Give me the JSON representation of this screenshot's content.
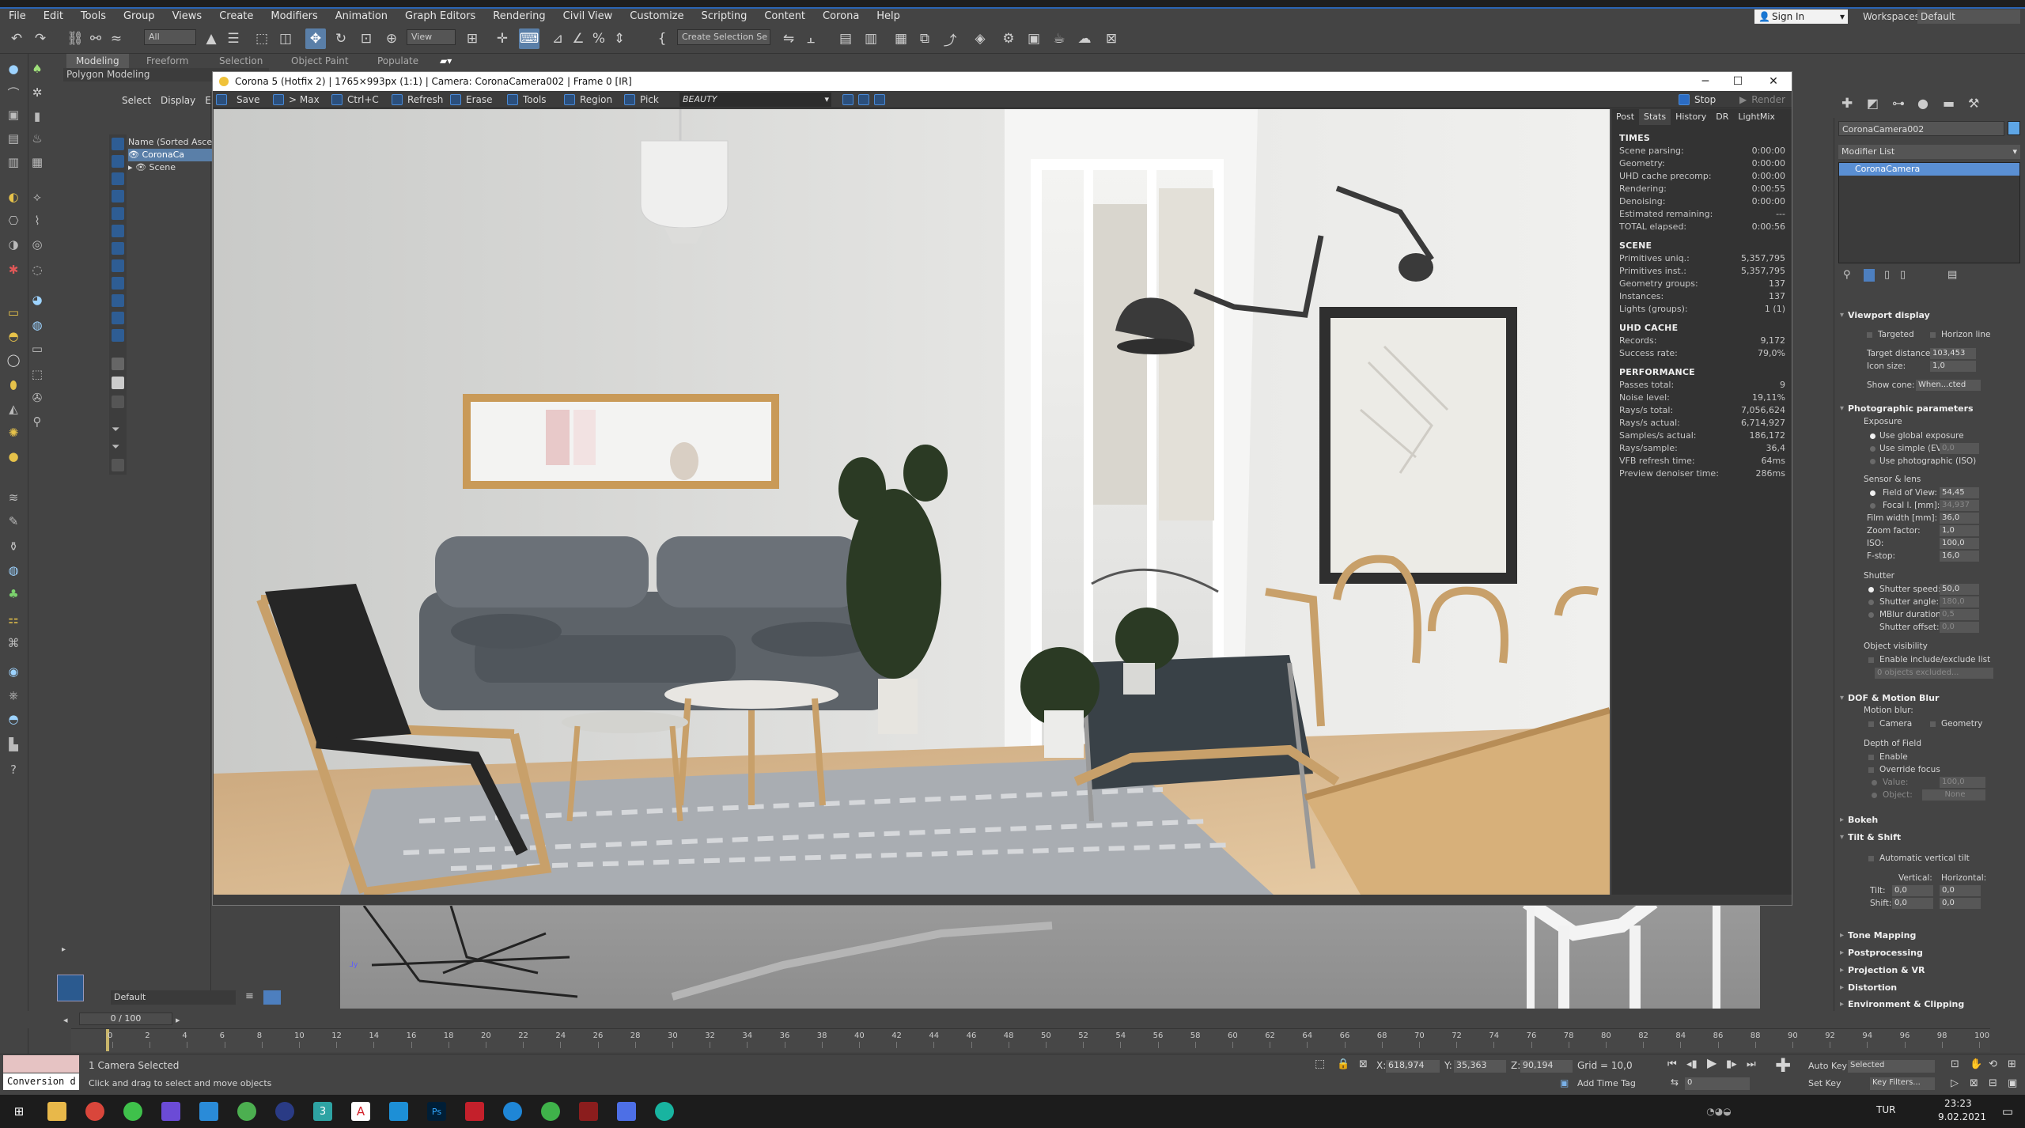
{
  "menu": [
    "File",
    "Edit",
    "Tools",
    "Group",
    "Views",
    "Create",
    "Modifiers",
    "Animation",
    "Graph Editors",
    "Rendering",
    "Civil View",
    "Customize",
    "Scripting",
    "Content",
    "Corona",
    "Help"
  ],
  "account": {
    "sign_in": "Sign In",
    "workspaces_label": "Workspaces:",
    "workspace": "Default"
  },
  "toolbar": {
    "filter": "All",
    "view": "View",
    "selection_set": "Create Selection Se"
  },
  "ribbon": {
    "tabs": [
      "Modeling",
      "Freeform",
      "Selection",
      "Object Paint",
      "Populate"
    ],
    "sub": "Polygon Modeling"
  },
  "scene_explorer": {
    "tabs": [
      "Select",
      "Display",
      "E"
    ],
    "header": "Name (Sorted Ascen",
    "items": [
      "CoronaCa",
      "Scene"
    ]
  },
  "layer": {
    "name": "Default"
  },
  "vfb": {
    "title": "Corona 5 (Hotfix 2) | 1765×993px (1:1) | Camera: CoronaCamera002 | Frame 0 [IR]",
    "toolbar": [
      "Save",
      "> Max",
      "Ctrl+C",
      "Refresh",
      "Erase",
      "Tools",
      "Region",
      "Pick"
    ],
    "channel": "BEAUTY",
    "stop": "Stop",
    "render": "Render",
    "tabs": [
      "Post",
      "Stats",
      "History",
      "DR",
      "LightMix"
    ],
    "stats": [
      {
        "section": "TIMES",
        "rows": [
          [
            "Scene parsing:",
            "0:00:00"
          ],
          [
            "Geometry:",
            "0:00:00"
          ],
          [
            "UHD cache precomp:",
            "0:00:00"
          ],
          [
            "Rendering:",
            "0:00:55"
          ],
          [
            "Denoising:",
            "0:00:00"
          ],
          [
            "Estimated remaining:",
            "---"
          ],
          [
            "TOTAL elapsed:",
            "0:00:56"
          ]
        ]
      },
      {
        "section": "SCENE",
        "rows": [
          [
            "Primitives uniq.:",
            "5,357,795"
          ],
          [
            "Primitives inst.:",
            "5,357,795"
          ],
          [
            "Geometry groups:",
            "137"
          ],
          [
            "Instances:",
            "137"
          ],
          [
            "Lights (groups):",
            "1 (1)"
          ]
        ]
      },
      {
        "section": "UHD CACHE",
        "rows": [
          [
            "Records:",
            "9,172"
          ],
          [
            "Success rate:",
            "79,0%"
          ]
        ]
      },
      {
        "section": "PERFORMANCE",
        "rows": [
          [
            "Passes total:",
            "9"
          ],
          [
            "Noise level:",
            "19,11%"
          ],
          [
            "Rays/s total:",
            "7,056,624"
          ],
          [
            "Rays/s actual:",
            "6,714,927"
          ],
          [
            "Samples/s actual:",
            "186,172"
          ],
          [
            "Rays/sample:",
            "36,4"
          ],
          [
            "VFB refresh time:",
            "64ms"
          ],
          [
            "Preview denoiser time:",
            "286ms"
          ]
        ]
      }
    ]
  },
  "command_panel": {
    "object_name": "CoronaCamera002",
    "modifier_list": "Modifier List",
    "stack_item": "CoronaCamera",
    "viewport_display": {
      "title": "Viewport display",
      "targeted": "Targeted",
      "horizon": "Horizon line",
      "target_distance_label": "Target distance:",
      "target_distance": "103,453",
      "icon_size_label": "Icon size:",
      "icon_size": "1,0",
      "show_cone_label": "Show cone:",
      "show_cone": "When...cted"
    },
    "photographic": {
      "title": "Photographic parameters",
      "exposure": "Exposure",
      "exp_options": [
        "Use global exposure",
        "Use simple (EV)",
        "Use photographic (ISO)"
      ],
      "ev_value": "0,0",
      "sensor": "Sensor & lens",
      "fov_label": "Field of View:",
      "fov": "54,45",
      "focal_label": "Focal l. [mm]:",
      "focal": "34,937",
      "film_label": "Film width [mm]:",
      "film": "36,0",
      "zoom_label": "Zoom factor:",
      "zoom": "1,0",
      "iso_label": "ISO:",
      "iso": "100,0",
      "fstop_label": "F-stop:",
      "fstop": "16,0",
      "shutter": "Shutter",
      "shutter_speed_label": "Shutter speed:",
      "shutter_speed": "50,0",
      "shutter_angle_label": "Shutter angle:",
      "shutter_angle": "180,0",
      "mblur_label": "MBlur duration:",
      "mblur": "0,5",
      "offset_label": "Shutter offset:",
      "offset": "0,0",
      "visibility": "Object visibility",
      "include": "Enable include/exclude list",
      "excluded": "0 objects excluded..."
    },
    "dof": {
      "title": "DOF & Motion Blur",
      "motion_blur": "Motion blur:",
      "camera": "Camera",
      "geometry": "Geometry",
      "depth": "Depth of Field",
      "enable": "Enable",
      "override": "Override focus",
      "value_label": "Value:",
      "value": "100,0",
      "object_label": "Object:",
      "object": "None"
    },
    "rollouts_closed": [
      "Bokeh"
    ],
    "tilt": {
      "title": "Tilt & Shift",
      "auto": "Automatic vertical tilt",
      "vertical": "Vertical:",
      "horizontal": "Horizontal:",
      "tilt_label": "Tilt:",
      "shift_label": "Shift:",
      "v_tilt": "0,0",
      "h_tilt": "0,0",
      "v_shift": "0,0",
      "h_shift": "0,0"
    },
    "rollouts_more": [
      "Tone Mapping",
      "Postprocessing",
      "Projection & VR",
      "Distortion",
      "Environment & Clipping"
    ]
  },
  "timeline": {
    "frame": "0 / 100",
    "ticks": [
      "0",
      "2",
      "4",
      "6",
      "8",
      "10",
      "12",
      "14",
      "16",
      "18",
      "20",
      "22",
      "24",
      "26",
      "28",
      "30",
      "32",
      "34",
      "36",
      "38",
      "40",
      "42",
      "44",
      "46",
      "48",
      "50",
      "52",
      "54",
      "56",
      "58",
      "60",
      "62",
      "64",
      "66",
      "68",
      "70",
      "72",
      "74",
      "76",
      "78",
      "80",
      "82",
      "84",
      "86",
      "88",
      "90",
      "92",
      "94",
      "96",
      "98",
      "100"
    ]
  },
  "status": {
    "selection": "1 Camera Selected",
    "prompt": "Click and drag to select and move objects",
    "maxscript": "Conversion d",
    "x_label": "X:",
    "x": "618,974",
    "y_label": "Y:",
    "y": "35,363",
    "z_label": "Z:",
    "z": "90,194",
    "grid": "Grid = 10,0",
    "add_time_tag": "Add Time Tag",
    "auto_key": "Auto Key",
    "set_key": "Set Key",
    "selected": "Selected",
    "key_filters": "Key Filters...",
    "frame_field": "0"
  },
  "taskbar": {
    "lang": "TUR",
    "time": "23:23",
    "date": "9.02.2021"
  }
}
